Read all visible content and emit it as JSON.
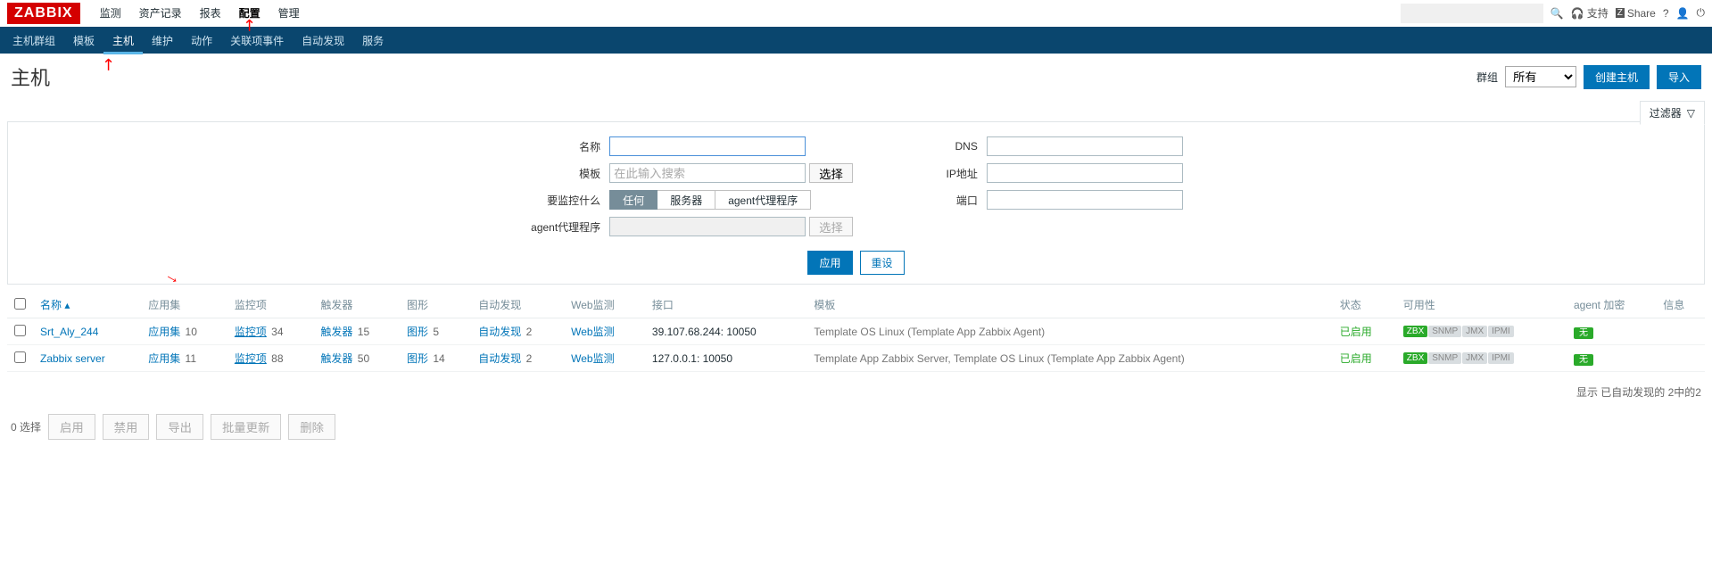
{
  "logo": "ZABBIX",
  "topnav": [
    "监测",
    "资产记录",
    "报表",
    "配置",
    "管理"
  ],
  "topnav_active": 3,
  "search_placeholder": "",
  "top_right": {
    "support": "支持",
    "share": "Share"
  },
  "subnav": [
    "主机群组",
    "模板",
    "主机",
    "维护",
    "动作",
    "关联项事件",
    "自动发现",
    "服务"
  ],
  "subnav_active": 2,
  "page_title": "主机",
  "group_label": "群组",
  "group_select": "所有",
  "btn_create": "创建主机",
  "btn_import": "导入",
  "filter_tab": "过滤器",
  "filter": {
    "name_label": "名称",
    "template_label": "模板",
    "template_placeholder": "在此输入搜索",
    "select_btn": "选择",
    "monitored_label": "要监控什么",
    "seg_any": "任何",
    "seg_server": "服务器",
    "seg_proxy": "agent代理程序",
    "proxy_label": "agent代理程序",
    "dns_label": "DNS",
    "ip_label": "IP地址",
    "port_label": "端口",
    "apply": "应用",
    "reset": "重设"
  },
  "columns": {
    "name": "名称",
    "apps": "应用集",
    "items": "监控项",
    "triggers": "触发器",
    "graphs": "图形",
    "discovery": "自动发现",
    "web": "Web监测",
    "interface": "接口",
    "templates": "模板",
    "status": "状态",
    "availability": "可用性",
    "encryption": "agent 加密",
    "info": "信息"
  },
  "rows": [
    {
      "name": "Srt_Aly_244",
      "apps": "10",
      "items": "34",
      "triggers": "15",
      "graphs": "5",
      "discovery": "2",
      "web": "",
      "interface": "39.107.68.244: 10050",
      "templates": "Template OS Linux (Template App Zabbix Agent)",
      "status": "已启用",
      "zbx": true,
      "enc": "无"
    },
    {
      "name": "Zabbix server",
      "apps": "11",
      "items": "88",
      "triggers": "50",
      "graphs": "14",
      "discovery": "2",
      "web": "",
      "interface": "127.0.0.1: 10050",
      "templates": "Template App Zabbix Server, Template OS Linux (Template App Zabbix Agent)",
      "status": "已启用",
      "zbx": true,
      "enc": "无"
    }
  ],
  "footer_text": "显示 已自动发现的 2中的2",
  "bottom": {
    "selected": "0 选择",
    "enable": "启用",
    "disable": "禁用",
    "export": "导出",
    "massupdate": "批量更新",
    "delete": "删除"
  },
  "avail_labels": [
    "ZBX",
    "SNMP",
    "JMX",
    "IPMI"
  ]
}
